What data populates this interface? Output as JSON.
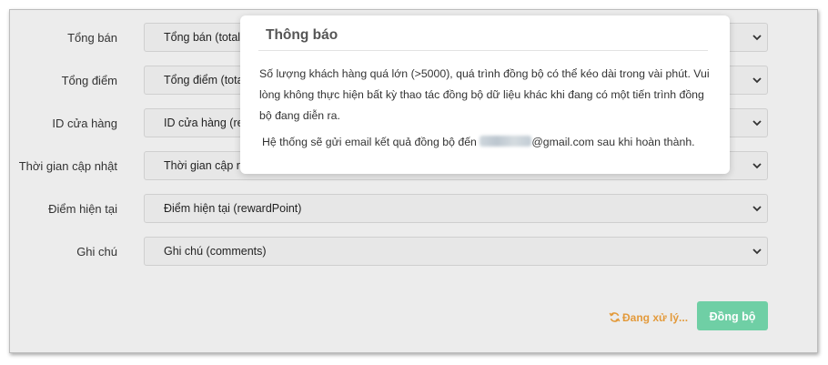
{
  "form": {
    "rows": [
      {
        "label": "Tổng bán",
        "value": "Tổng bán (totalg"
      },
      {
        "label": "Tổng điểm",
        "value": "Tổng điểm (totalp"
      },
      {
        "label": "ID cửa hàng",
        "value": "ID cửa hàng (re"
      },
      {
        "label": "Thời gian cập nhật",
        "value": "Thời gian cập n"
      },
      {
        "label": "Điểm hiện tại",
        "value": "Điểm hiện tại (rewardPoint)"
      },
      {
        "label": "Ghi chú",
        "value": "Ghi chú (comments)"
      }
    ]
  },
  "footer": {
    "status_text": "Đang xử lý...",
    "sync_label": "Đồng bộ"
  },
  "modal": {
    "title": "Thông báo",
    "message_1": "Số lượng khách hàng quá lớn (>5000), quá trình đồng bộ có thể kéo dài trong vài phút. Vui lòng không thực hiện bất kỳ thao tác đồng bộ dữ liệu khác khi đang có một tiến trình đồng bộ đang diễn ra.",
    "message_2_prefix": "Hệ thống sẽ gửi email kết quả đồng bộ đến ",
    "message_2_suffix": "@gmail.com sau khi hoàn thành."
  },
  "colors": {
    "accent_green": "#6fcfa5",
    "status_orange": "#e39a3b"
  }
}
